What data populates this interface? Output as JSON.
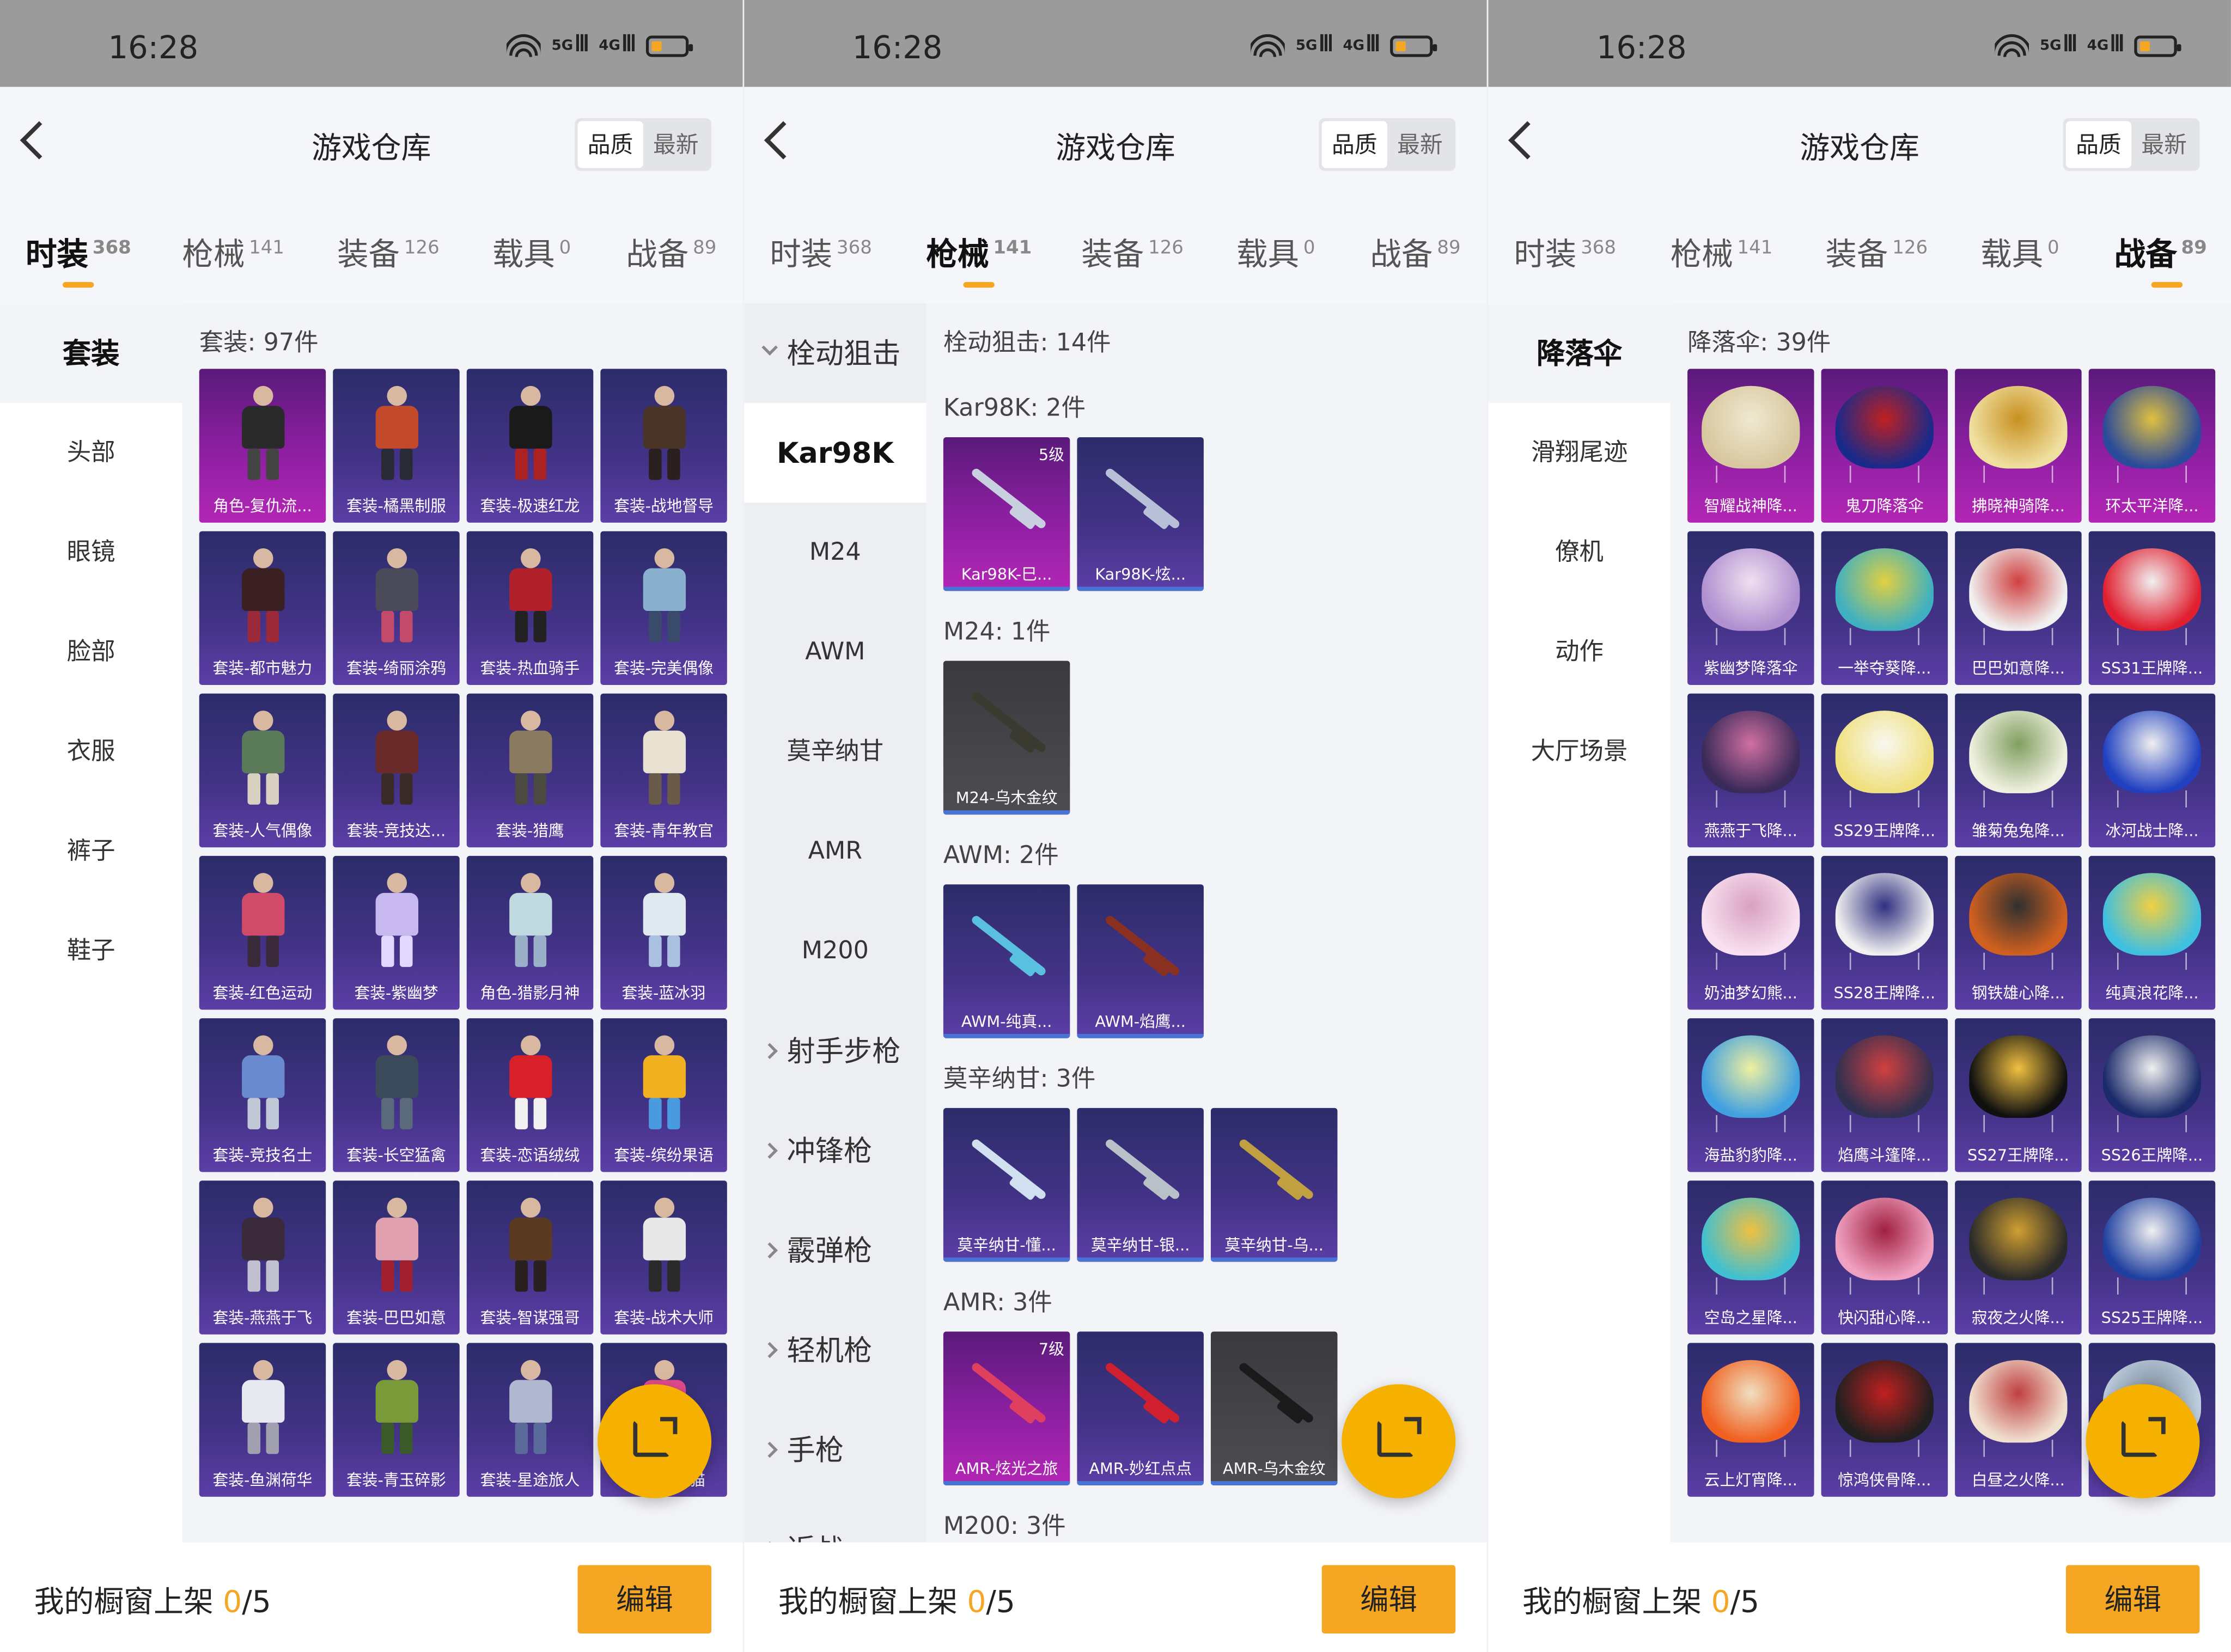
{
  "status_bar": {
    "time": "16:28",
    "net1": "5G",
    "net2": "4G"
  },
  "header": {
    "title": "游戏仓库",
    "sort_quality": "品质",
    "sort_newest": "最新",
    "edit_label": "编辑"
  },
  "tabs": [
    {
      "label": "时装",
      "count": "368"
    },
    {
      "label": "枪械",
      "count": "141"
    },
    {
      "label": "装备",
      "count": "126"
    },
    {
      "label": "载具",
      "count": "0"
    },
    {
      "label": "战备",
      "count": "89"
    }
  ],
  "footer": {
    "label": "我的橱窗上架",
    "count": "0",
    "total": "/5",
    "button": "编辑"
  },
  "screens": [
    {
      "active_tab": 0,
      "sidebar": [
        "套装",
        "头部",
        "眼镜",
        "脸部",
        "衣服",
        "裤子",
        "鞋子"
      ],
      "section_title": "套装: 97件",
      "items": [
        "角色-复仇流...",
        "套装-橘黑制服",
        "套装-极速红龙",
        "套装-战地督导",
        "套装-都市魅力",
        "套装-绮丽涂鸦",
        "套装-热血骑手",
        "套装-完美偶像",
        "套装-人气偶像",
        "套装-竞技达...",
        "套装-猎鹰",
        "套装-青年教官",
        "套装-红色运动",
        "套装-紫幽梦",
        "角色-猎影月神",
        "套装-蓝冰羽",
        "套装-竞技名士",
        "套装-长空猛禽",
        "套装-恋语绒绒",
        "套装-缤纷果语",
        "套装-燕燕于飞",
        "套装-巴巴如意",
        "套装-智谋强哥",
        "套装-战术大师",
        "套装-鱼渊荷华",
        "套装-青玉碎影",
        "套装-星途旅人",
        "套装-...熊猫"
      ]
    },
    {
      "active_tab": 1,
      "sidebar_group_open": "栓动狙击",
      "sidebar": [
        "Kar98K",
        "M24",
        "AWM",
        "莫辛纳甘",
        "AMR",
        "M200"
      ],
      "sidebar_groups": [
        "射手步枪",
        "冲锋枪",
        "霰弹枪",
        "轻机枪",
        "手枪",
        "近战"
      ],
      "section_title": "栓动狙击: 14件",
      "groups": [
        {
          "title": "Kar98K: 2件",
          "items": [
            {
              "name": "Kar98K-巳...",
              "level": "5级"
            },
            {
              "name": "Kar98K-炫...",
              "level": ""
            }
          ]
        },
        {
          "title": "M24: 1件",
          "items": [
            {
              "name": "M24-乌木金纹",
              "level": ""
            }
          ]
        },
        {
          "title": "AWM: 2件",
          "items": [
            {
              "name": "AWM-纯真...",
              "level": ""
            },
            {
              "name": "AWM-焰鹰...",
              "level": ""
            }
          ]
        },
        {
          "title": "莫辛纳甘: 3件",
          "items": [
            {
              "name": "莫辛纳甘-懂...",
              "level": ""
            },
            {
              "name": "莫辛纳甘-银...",
              "level": ""
            },
            {
              "name": "莫辛纳甘-乌...",
              "level": ""
            }
          ]
        },
        {
          "title": "AMR: 3件",
          "items": [
            {
              "name": "AMR-炫光之旅",
              "level": "7级"
            },
            {
              "name": "AMR-妙红点点",
              "level": ""
            },
            {
              "name": "AMR-乌木金纹",
              "level": ""
            }
          ]
        },
        {
          "title": "M200: 3件",
          "items": []
        }
      ]
    },
    {
      "active_tab": 4,
      "sidebar": [
        "降落伞",
        "滑翔尾迹",
        "僚机",
        "动作",
        "大厅场景"
      ],
      "section_title": "降落伞: 39件",
      "items": [
        "智耀战神降...",
        "鬼刀降落伞",
        "拂晓神骑降...",
        "环太平洋降...",
        "紫幽梦降落伞",
        "一举夺葵降...",
        "巴巴如意降...",
        "SS31王牌降...",
        "燕燕于飞降...",
        "SS29王牌降...",
        "雏菊兔兔降...",
        "冰河战士降...",
        "奶油梦幻熊...",
        "SS28王牌降...",
        "钢铁雄心降...",
        "纯真浪花降...",
        "海盐豹豹降...",
        "焰鹰斗篷降...",
        "SS27王牌降...",
        "SS26王牌降...",
        "空岛之星降...",
        "快闪甜心降...",
        "寂夜之火降...",
        "SS25王牌降...",
        "云上灯宵降...",
        "惊鸿侠骨降...",
        "白昼之火降...",
        ""
      ]
    }
  ]
}
